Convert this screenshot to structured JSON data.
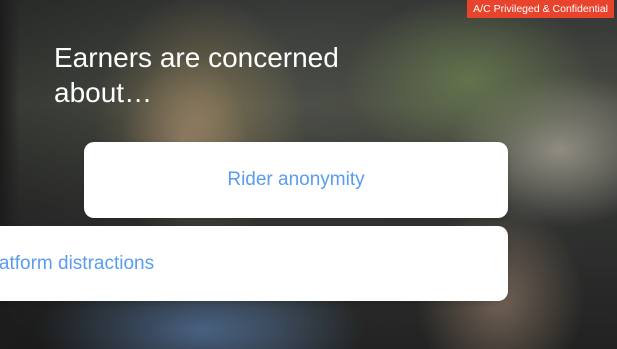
{
  "slide": {
    "badge": "A/C Privileged & Confidential",
    "title": "Earners are concerned about…",
    "concerns": [
      {
        "label": "Rider anonymity"
      },
      {
        "label": "Platform distractions"
      }
    ]
  },
  "colors": {
    "badge_bg": "#e8432d",
    "card_text": "#5a9cf0",
    "card_bg": "#ffffff",
    "title_text": "#ffffff"
  }
}
